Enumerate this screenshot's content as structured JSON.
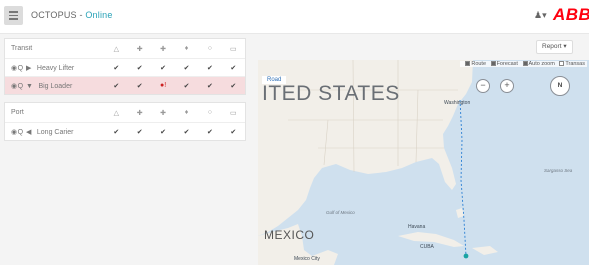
{
  "header": {
    "app_name": "OCTOPUS - ",
    "status": "Online",
    "user_icon": "user-icon",
    "logo_text": "ABB"
  },
  "column_icons": [
    "alarm-bell-icon",
    "crosshair-icon",
    "crosshair-icon",
    "dot-icon",
    "circle-icon",
    "grid-icon"
  ],
  "column_glyphs": [
    "△",
    "✚",
    "✚",
    "♦",
    "○",
    "▭"
  ],
  "groups": [
    {
      "title": "Transit",
      "vessels": [
        {
          "name": "Heavy Lifter",
          "controls": "◉Q ▶",
          "status": [
            "✔",
            "✔",
            "✔",
            "✔",
            "✔",
            "✔"
          ],
          "alarm": false
        },
        {
          "name": "Big Loader",
          "controls": "◉Q ▼",
          "status": [
            "✔",
            "✔",
            "●!",
            "✔",
            "✔",
            "✔"
          ],
          "alarm": true
        }
      ]
    },
    {
      "title": "Port",
      "vessels": [
        {
          "name": "Long Carier",
          "controls": "◉Q ◀",
          "status": [
            "✔",
            "✔",
            "✔",
            "✔",
            "✔",
            "✔"
          ],
          "alarm": false
        }
      ]
    }
  ],
  "map": {
    "report_button": "Report ▾",
    "options": [
      "Route",
      "Forecast",
      "Auto zoom",
      "Transas"
    ],
    "options_checked": [
      true,
      true,
      true,
      false
    ],
    "map_type": "Road",
    "country_label_us": "ITED STATES",
    "country_label_mx": "MEXICO",
    "gulf_label": "Gulf of Mexico",
    "cities": [
      "Washington",
      "Havana",
      "Mexico City"
    ],
    "cuba_label": "CUBA",
    "sea_label": "Sargasso Sea",
    "compass_label": "N",
    "zoom_out": "−",
    "zoom_in": "+",
    "colors": {
      "water": "#cfe0ee",
      "land": "#f2efe9",
      "route": "#2a7fd4",
      "alarm_row": "#f6dcde",
      "online": "#2aa3b8",
      "brand": "#ff000f"
    }
  }
}
